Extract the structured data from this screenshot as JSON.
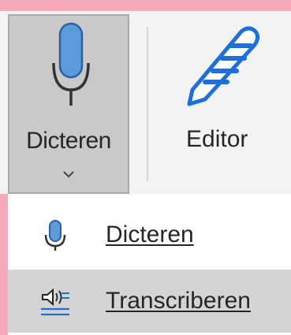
{
  "ribbon": {
    "dictate_button": {
      "label": "Dicteren",
      "icon": "microphone-icon"
    },
    "editor_button": {
      "label": "Editor",
      "icon": "editor-pen-icon"
    }
  },
  "menu": {
    "items": [
      {
        "label": "Dicteren",
        "icon": "microphone-icon"
      },
      {
        "label": "Transcriberen",
        "icon": "transcribe-icon"
      }
    ]
  },
  "colors": {
    "background": "#f4aab9",
    "accent_blue": "#1e6fd9",
    "mic_fill": "#5b9bd9",
    "hover_gray": "#d4d4d4"
  }
}
